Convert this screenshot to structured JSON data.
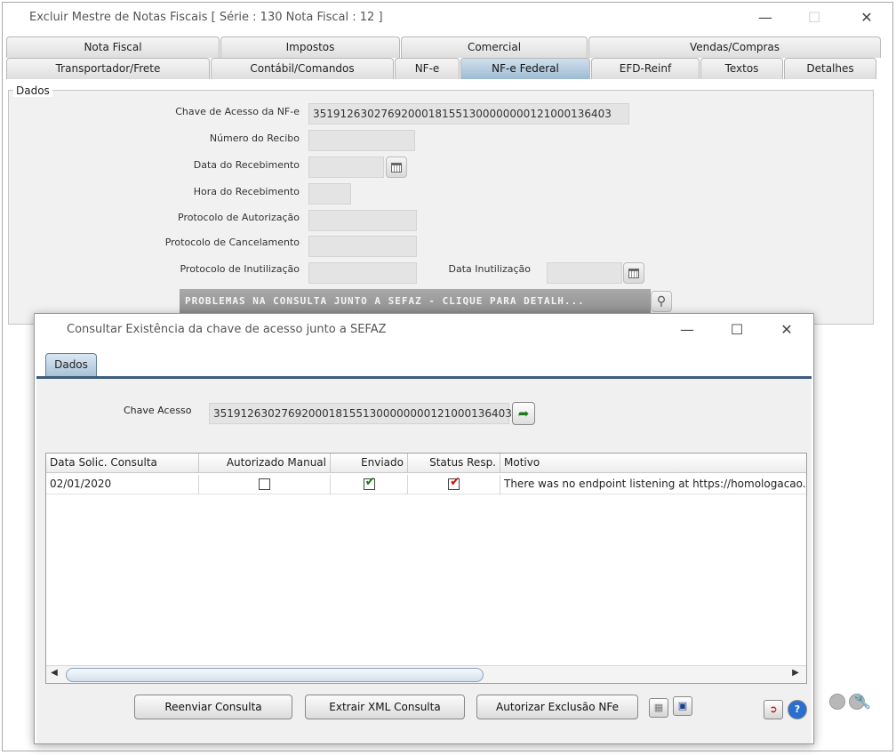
{
  "main_window": {
    "title": "Excluir Mestre de Notas Fiscais [ Série : 130 Nota Fiscal : 12 ]",
    "controls": {
      "minimize": "—",
      "maximize": "☐",
      "close": "✕"
    }
  },
  "tabs_top": [
    "Nota Fiscal",
    "Impostos",
    "Comercial",
    "Vendas/Compras"
  ],
  "tabs_bottom": [
    "Transportador/Frete",
    "Contábil/Comandos",
    "NF-e",
    "NF-e Federal",
    "EFD-Reinf",
    "Textos",
    "Detalhes"
  ],
  "active_tab": "NF-e Federal",
  "dados_section": {
    "legend": "Dados",
    "fields": {
      "chave_acesso": {
        "label": "Chave de Acesso da NF-e",
        "value": "35191263027692000181551300000000121000136403"
      },
      "numero_recibo": {
        "label": "Número do Recibo",
        "value": ""
      },
      "data_recebimento": {
        "label": "Data do Recebimento",
        "value": ""
      },
      "hora_recebimento": {
        "label": "Hora do Recebimento",
        "value": ""
      },
      "protocolo_autorizacao": {
        "label": "Protocolo de Autorização",
        "value": ""
      },
      "protocolo_cancelamento": {
        "label": "Protocolo de Cancelamento",
        "value": ""
      },
      "protocolo_inutilizacao": {
        "label": "Protocolo de Inutilização",
        "value": ""
      },
      "data_inutilizacao": {
        "label": "Data Inutilização",
        "value": ""
      }
    },
    "sefaz_banner": "PROBLEMAS NA CONSULTA JUNTO A SEFAZ - CLIQUE PARA DETALH..."
  },
  "dialog": {
    "title": "Consultar Existência da chave de acesso junto a SEFAZ",
    "controls": {
      "minimize": "—",
      "maximize": "☐",
      "close": "✕"
    },
    "tab": "Dados",
    "chave_label": "Chave Acesso",
    "chave_value": "35191263027692000181551300000000121000136403",
    "grid": {
      "columns": [
        "Data Solic. Consulta",
        "Autorizado Manual",
        "Enviado",
        "Status Resp.",
        "Motivo"
      ],
      "rows": [
        {
          "data": "02/01/2020",
          "autorizado_manual": false,
          "enviado": true,
          "status_resp": true,
          "motivo": "There was no endpoint listening at https://homologacao."
        }
      ]
    },
    "buttons": {
      "reenviar": "Reenviar Consulta",
      "extrair": "Extrair XML Consulta",
      "autorizar": "Autorizar Exclusão NFe"
    }
  },
  "icons": {
    "calendar": "calendar-icon",
    "zoom": "magnifier-icon",
    "refresh": "refresh-arrow-icon",
    "exit": "exit-door-icon",
    "help": "help-icon",
    "wrench": "wrench-icon"
  },
  "colors": {
    "enviado_check": "#1a7a1a",
    "status_check": "#d01010",
    "active_tab": "#9fbbd2",
    "dialog_tabline": "#3d5a7a"
  }
}
